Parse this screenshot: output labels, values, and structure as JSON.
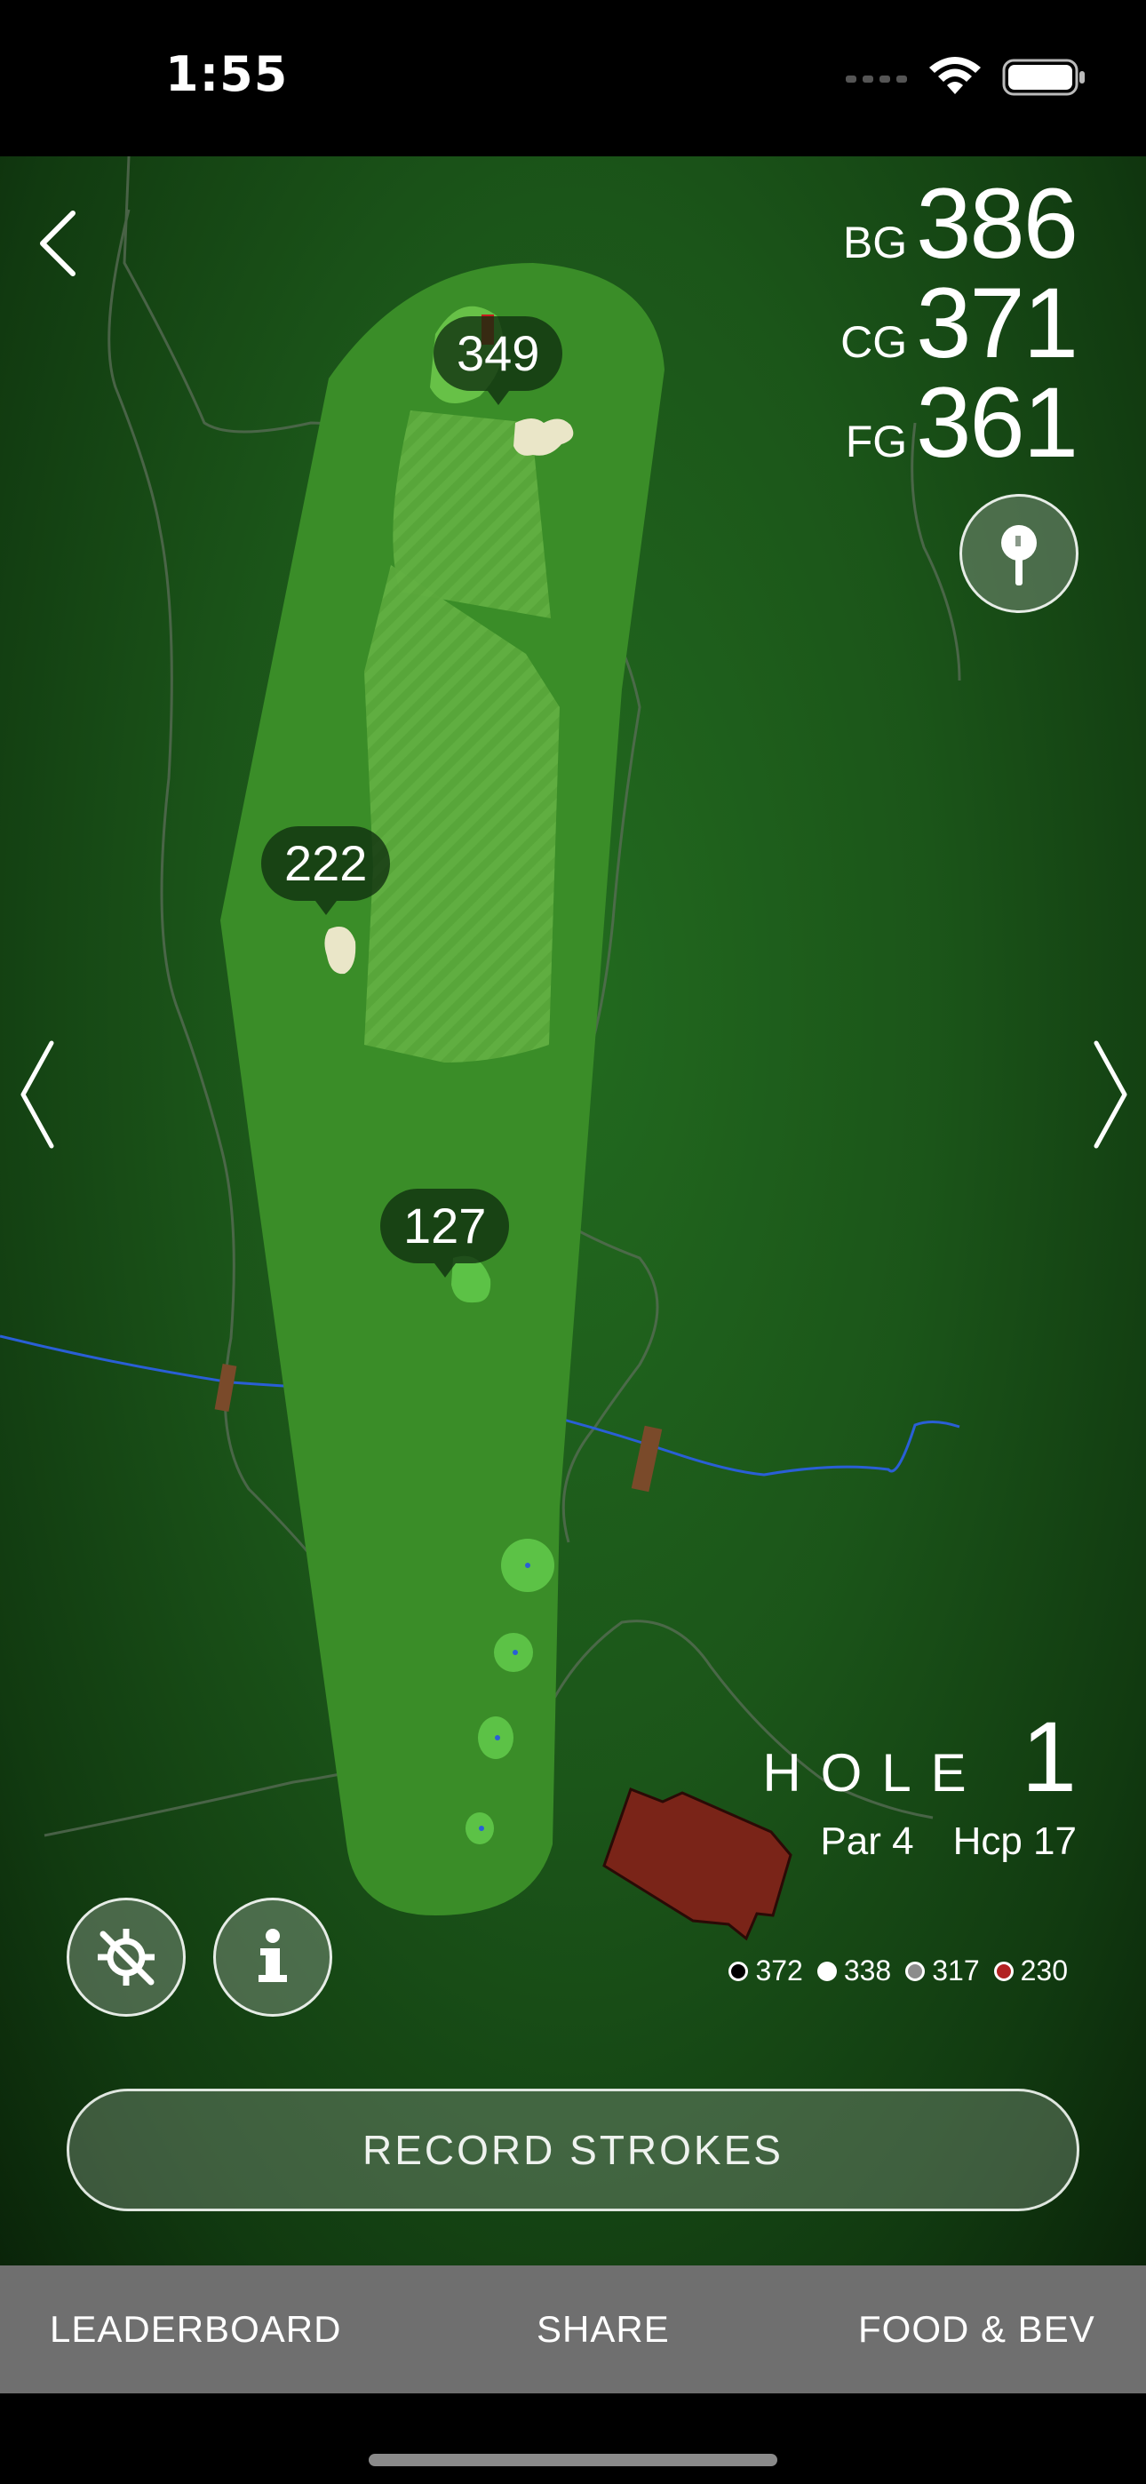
{
  "status_bar": {
    "time": "1:55"
  },
  "yardages": [
    {
      "label": "BG",
      "value": "386"
    },
    {
      "label": "CG",
      "value": "371"
    },
    {
      "label": "FG",
      "value": "361"
    }
  ],
  "markers": {
    "far": "349",
    "mid": "222",
    "near": "127"
  },
  "hole": {
    "word": "HOLE",
    "number": "1",
    "par": "Par 4",
    "hcp": "Hcp 17"
  },
  "tees": [
    {
      "value": "372",
      "color": "#000000",
      "ring": "#ffffff"
    },
    {
      "value": "338",
      "color": "#ffffff",
      "ring": "#ffffff"
    },
    {
      "value": "317",
      "color": "#8c8c8c",
      "ring": "#ffffff"
    },
    {
      "value": "230",
      "color": "#b22222",
      "ring": "#ffffff"
    }
  ],
  "record_button": "RECORD STROKES",
  "tabs": {
    "leaderboard": "LEADERBOARD",
    "share": "SHARE",
    "food": "FOOD & BEV"
  },
  "colors": {
    "fairway": "#3f9a2a",
    "rough": "#2f7f22",
    "water": "#2a5fd6",
    "building": "#7a2418"
  }
}
